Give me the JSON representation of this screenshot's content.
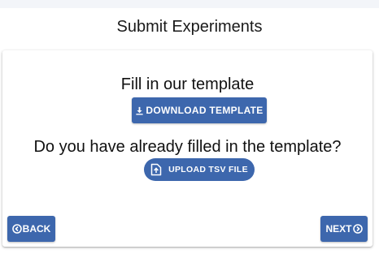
{
  "page": {
    "title": "Submit Experiments"
  },
  "template_section": {
    "heading": "Fill in our template",
    "download_label": "DOWNLOAD TEMPLATE",
    "download_icon": "download-icon"
  },
  "upload_section": {
    "question": "Do you have already filled in the template?",
    "upload_label": "UPLOAD TSV FILE",
    "upload_icon": "file-upload-icon"
  },
  "navigation": {
    "back_label": "BACK",
    "back_icon": "chevron-left-circle-icon",
    "next_label": "NEXT",
    "next_icon": "chevron-right-circle-icon"
  },
  "colors": {
    "primary": "#3d67ad",
    "background": "#ffffff",
    "top_strip": "#f3f5f9"
  }
}
